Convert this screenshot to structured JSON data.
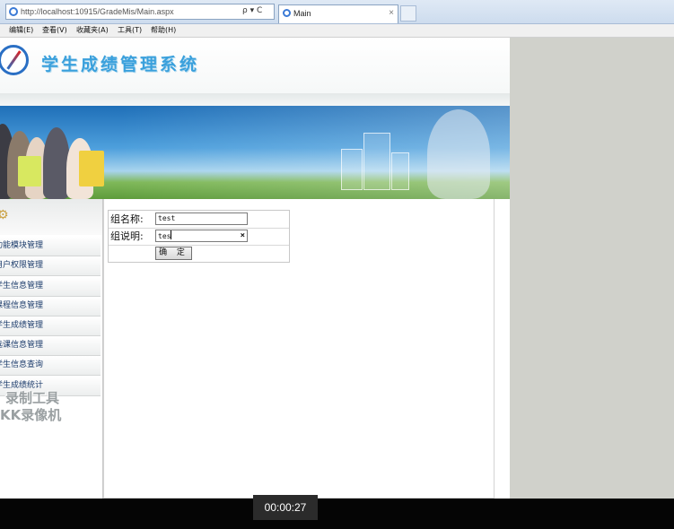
{
  "browser": {
    "address": "http://localhost:10915/GradeMis/Main.aspx",
    "address_controls": "ρ ▾ C",
    "tab_title": "Main",
    "tab_close": "×"
  },
  "menu": [
    "编辑(E)",
    "查看(V)",
    "收藏夹(A)",
    "工具(T)",
    "帮助(H)"
  ],
  "header": {
    "title": "学生成绩管理系统"
  },
  "sidebar": {
    "items": [
      "功能模块管理",
      "用户权限管理",
      "学生信息管理",
      "课程信息管理",
      "学生成绩管理",
      "选课信息管理",
      "学生信息查询",
      "学生成绩统计"
    ]
  },
  "watermark": {
    "line1": "录制工具",
    "line2": "KK录像机"
  },
  "form": {
    "name_label": "组名称:",
    "name_value": "test",
    "desc_label": "组说明:",
    "desc_value": "tes",
    "clear_icon": "×",
    "submit_label": "确 定"
  },
  "recorder": {
    "time": "00:00:27"
  }
}
